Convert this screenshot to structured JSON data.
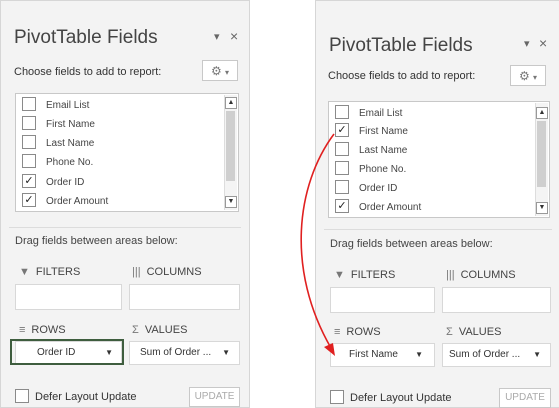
{
  "panel_before": {
    "title": "PivotTable Fields",
    "choose_label": "Choose fields to add to report:",
    "fields": [
      {
        "label": "Email List",
        "checked": false
      },
      {
        "label": "First Name",
        "checked": false
      },
      {
        "label": "Last Name",
        "checked": false
      },
      {
        "label": "Phone No.",
        "checked": false
      },
      {
        "label": "Order ID",
        "checked": true
      },
      {
        "label": "Order Amount",
        "checked": true
      }
    ],
    "drag_label": "Drag fields between areas below:",
    "filters_label": "FILTERS",
    "columns_label": "COLUMNS",
    "rows_label": "ROWS",
    "values_label": "VALUES",
    "rows_item": "Order ID",
    "values_item": "Sum of Order ...",
    "defer_label": "Defer Layout Update",
    "update_label": "UPDATE"
  },
  "panel_after": {
    "title": "PivotTable Fields",
    "choose_label": "Choose fields to add to report:",
    "fields": [
      {
        "label": "Email List",
        "checked": false
      },
      {
        "label": "First Name",
        "checked": true
      },
      {
        "label": "Last Name",
        "checked": false
      },
      {
        "label": "Phone No.",
        "checked": false
      },
      {
        "label": "Order ID",
        "checked": false
      },
      {
        "label": "Order Amount",
        "checked": true
      }
    ],
    "drag_label": "Drag fields between areas below:",
    "filters_label": "FILTERS",
    "columns_label": "COLUMNS",
    "rows_label": "ROWS",
    "values_label": "VALUES",
    "rows_item": "First Name",
    "values_item": "Sum of Order ...",
    "defer_label": "Defer Layout Update",
    "update_label": "UPDATE"
  },
  "icons": {
    "dropdown": "▾",
    "close": "×",
    "gear": "⚙",
    "check": "✓",
    "filter": "filter-icon",
    "columns": "columns-icon",
    "rows": "rows-icon",
    "values": "sigma-icon"
  },
  "colors": {
    "highlight_border": "#3e5d3e",
    "arrow": "#e02020"
  }
}
